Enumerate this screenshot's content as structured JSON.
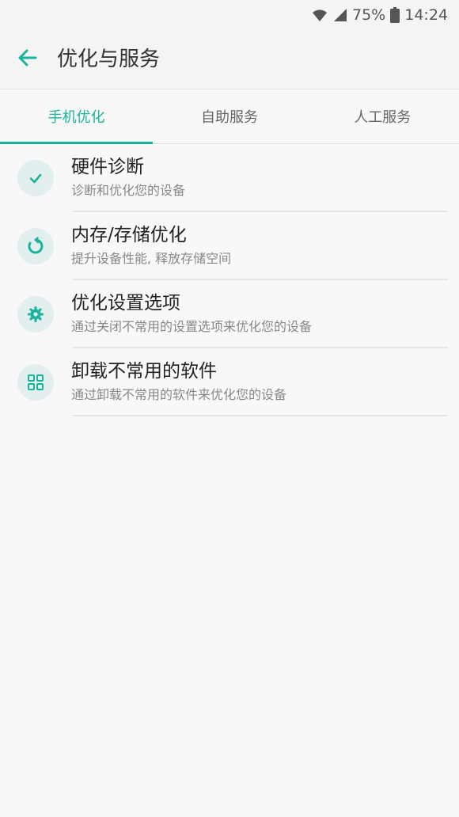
{
  "status_bar": {
    "battery_percent": "75%",
    "time": "14:24"
  },
  "app_bar": {
    "title": "优化与服务"
  },
  "tabs": [
    {
      "label": "手机优化",
      "active": true
    },
    {
      "label": "自助服务",
      "active": false
    },
    {
      "label": "人工服务",
      "active": false
    }
  ],
  "items": [
    {
      "icon": "check-icon",
      "title": "硬件诊断",
      "subtitle": "诊断和优化您的设备"
    },
    {
      "icon": "refresh-icon",
      "title": "内存/存储优化",
      "subtitle": "提升设备性能, 释放存储空间"
    },
    {
      "icon": "gear-icon",
      "title": "优化设置选项",
      "subtitle": "通过关闭不常用的设置选项来优化您的设备"
    },
    {
      "icon": "grid-icon",
      "title": "卸载不常用的软件",
      "subtitle": "通过卸载不常用的软件来优化您的设备"
    }
  ],
  "colors": {
    "accent": "#1ab39c",
    "icon_bg": "#e3eeee"
  }
}
